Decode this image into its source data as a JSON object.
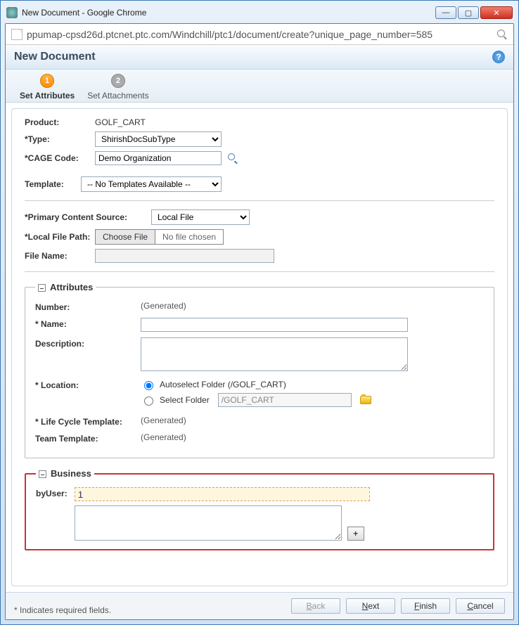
{
  "window": {
    "title": "New Document - Google Chrome"
  },
  "controls": {
    "minimize": "—",
    "maximize": "▢",
    "close": "✕"
  },
  "url": "ppumap-cpsd26d.ptcnet.ptc.com/Windchill/ptc1/document/create?unique_page_number=585",
  "header": {
    "title": "New Document",
    "help": "?"
  },
  "wizard": {
    "step1": {
      "num": "1",
      "label": "Set Attributes"
    },
    "step2": {
      "num": "2",
      "label": "Set Attachments"
    }
  },
  "top": {
    "product_label": "Product:",
    "product_value": "GOLF_CART",
    "type_label": "*Type:",
    "type_value": "ShirishDocSubType",
    "cage_label": "*CAGE Code:",
    "cage_value": "Demo Organization",
    "template_label": "Template:",
    "template_value": "-- No Templates Available --"
  },
  "content": {
    "source_label": "*Primary Content Source:",
    "source_value": "Local File",
    "localpath_label": "*Local File Path:",
    "choose_btn": "Choose File",
    "choose_txt": "No file chosen",
    "filename_label": "File Name:",
    "filename_value": ""
  },
  "attributes": {
    "legend": "Attributes",
    "number_label": "Number:",
    "number_value": "(Generated)",
    "name_label": "* Name:",
    "name_value": "",
    "description_label": "Description:",
    "description_value": "",
    "location_label": "* Location:",
    "auto_label": "Autoselect Folder (/GOLF_CART)",
    "select_label": "Select Folder",
    "select_path": "/GOLF_CART",
    "lifecycle_label": "* Life Cycle Template:",
    "lifecycle_value": "(Generated)",
    "team_label": "Team Template:",
    "team_value": "(Generated)"
  },
  "business": {
    "legend": "Business",
    "byuser_label": "byUser:",
    "byuser_value": "1",
    "plus": "+"
  },
  "footer": {
    "hint": "* Indicates required fields.",
    "back": "Back",
    "next": "Next",
    "finish": "Finish",
    "cancel": "Cancel"
  }
}
